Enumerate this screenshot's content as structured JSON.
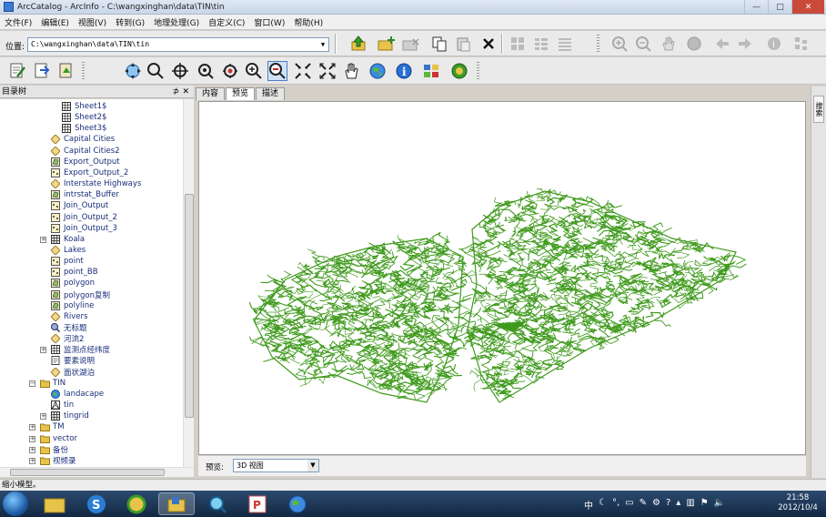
{
  "window": {
    "title": "ArcCatalog - ArcInfo - C:\\wangxinghan\\data\\TIN\\tin",
    "minimize": "—",
    "maximize": "□",
    "close": "✕"
  },
  "menu": [
    "文件(F)",
    "编辑(E)",
    "视图(V)",
    "转到(G)",
    "地理处理(G)",
    "自定义(C)",
    "窗口(W)",
    "帮助(H)"
  ],
  "location": {
    "label": "位置:",
    "value": "C:\\wangxinghan\\data\\TIN\\tin"
  },
  "catalog_tree": {
    "header": "目录树",
    "pin": "⊅",
    "close": "✕",
    "items": [
      "Sheet1$",
      "Sheet2$",
      "Sheet3$",
      "Capital Cities",
      "Capital Cities2",
      "Export_Output",
      "Export_Output_2",
      "Interstate Highways",
      "intrstat_Buffer",
      "Join_Output",
      "Join_Output_2",
      "Join_Output_3",
      "Koala",
      "Lakes",
      "point",
      "point_BB",
      "polygon",
      "polygon复制",
      "polyline",
      "Rivers",
      "无标题",
      "河流2",
      "监测点经纬度",
      "要素说明",
      "面状湖泊",
      "TIN",
      "landacape",
      "tin",
      "tingrid",
      "TM",
      "vector",
      "备份",
      "视频录"
    ]
  },
  "tabs": [
    "内容",
    "预览",
    "描述"
  ],
  "active_tab": "预览",
  "preview": {
    "label": "预览:",
    "selected": "3D 视图"
  },
  "right_strip_label": "搜索",
  "status": "缩小模型。",
  "taskbar": {
    "time": "21:58",
    "date": "2012/10/4",
    "tray_lang": "中"
  },
  "colors": {
    "tin_green": "#3f9a1c",
    "selection_blue": "#3b7bd4"
  }
}
